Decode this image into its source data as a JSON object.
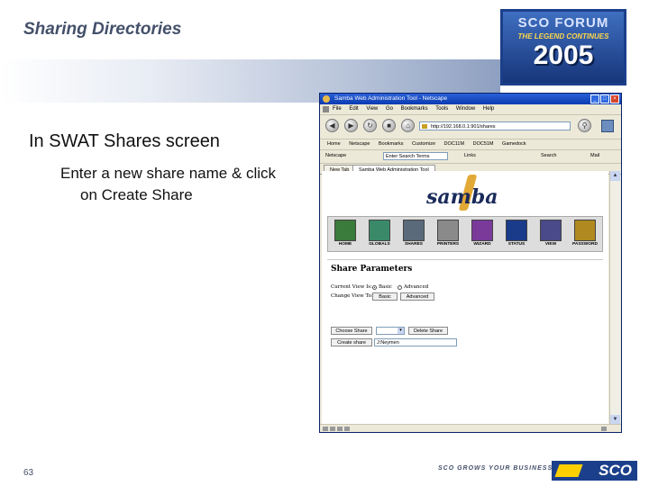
{
  "slide": {
    "title": "Sharing Directories",
    "bullet1": "In SWAT Shares screen",
    "bullet2_line1": "Enter a new share name & click",
    "bullet2_line2": "on Create Share",
    "page_number": "63",
    "footer_tagline": "SCO GROWS YOUR BUSINESS",
    "footer_logo": "SCO"
  },
  "logo": {
    "line1": "SCO FORUM",
    "line2": "THE LEGEND CONTINUES",
    "line3": "2005"
  },
  "browser": {
    "title": "Samba Web Administration Tool - Netscape",
    "menu": [
      "File",
      "Edit",
      "View",
      "Go",
      "Bookmarks",
      "Tools",
      "Window",
      "Help"
    ],
    "url": "http://192.168.0.1:901/shares",
    "bookmarks": [
      "Home",
      "Netscape",
      "Bookmarks",
      "Customize",
      "DOC11M",
      "DOC51M",
      "Gamedock"
    ],
    "netscape_label": "Netscape",
    "search_placeholder": "Enter Search Terms",
    "toolbar_items": [
      "Links",
      "Search",
      "Mail"
    ],
    "tabs": [
      "New Tab",
      "Samba Web Administration Tool"
    ],
    "samba_logo": "samba",
    "nav_icons": [
      {
        "label": "HOME",
        "icon": "home-icon",
        "color": "#3a7a3a"
      },
      {
        "label": "GLOBALS",
        "icon": "globe-icon",
        "color": "#3a8a6a"
      },
      {
        "label": "SHARES",
        "icon": "shares-icon",
        "color": "#5a6a7a"
      },
      {
        "label": "PRINTERS",
        "icon": "printer-icon",
        "color": "#8a8a8a"
      },
      {
        "label": "WIZARD",
        "icon": "wizard-icon",
        "color": "#7a3a9a"
      },
      {
        "label": "STATUS",
        "icon": "status-icon",
        "color": "#1a3a8a"
      },
      {
        "label": "VIEW",
        "icon": "view-icon",
        "color": "#4a4a8a"
      },
      {
        "label": "PASSWORD",
        "icon": "password-icon",
        "color": "#b08a20"
      }
    ],
    "share_params_heading": "Share Parameters",
    "current_view_label": "Current View Is:",
    "view_basic": "Basic",
    "view_advanced": "Advanced",
    "change_view_label": "Change View To:",
    "basic_button": "Basic",
    "advanced_button": "Advanced",
    "choose_share_button": "Choose Share",
    "delete_share_button": "Delete Share",
    "create_share_button": "Create share",
    "new_share_name": "J:Neymen"
  }
}
